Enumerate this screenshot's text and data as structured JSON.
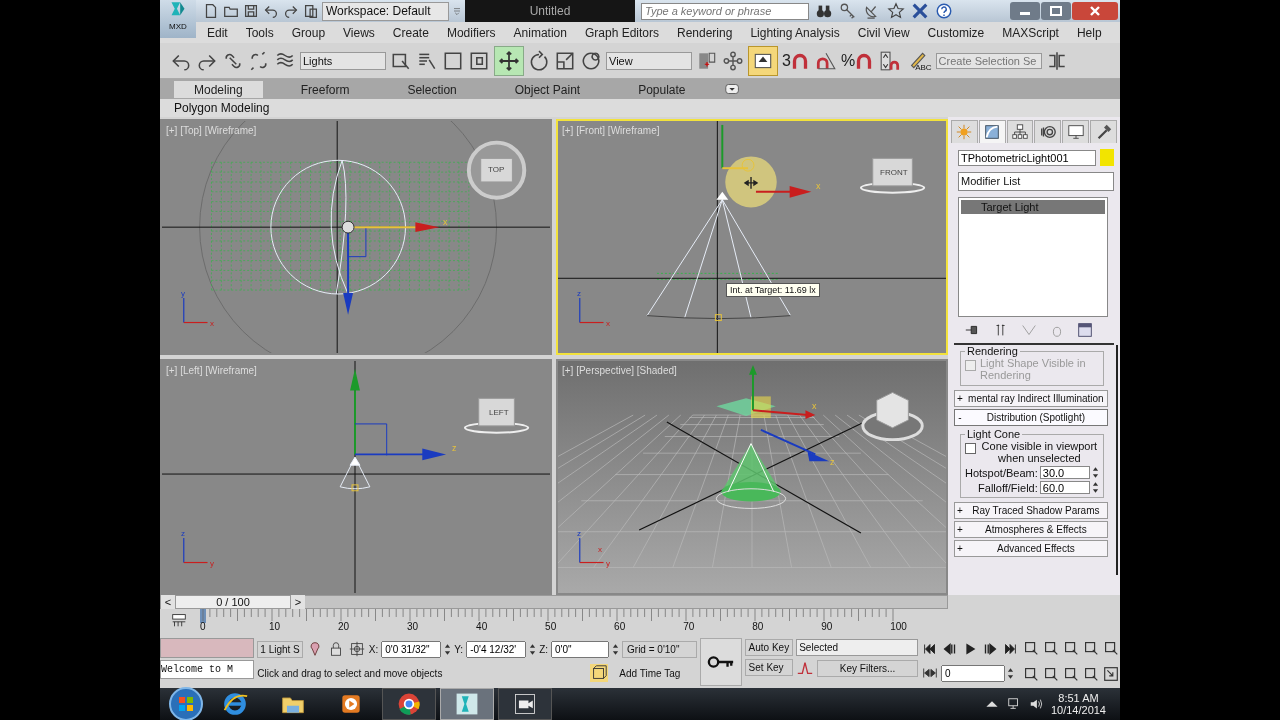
{
  "title_bar": {
    "app_badge": "MXD",
    "workspace": "Workspace: Default",
    "title": "Untitled",
    "search_placeholder": "Type a keyword or phrase"
  },
  "menu": [
    "Edit",
    "Tools",
    "Group",
    "Views",
    "Create",
    "Modifiers",
    "Animation",
    "Graph Editors",
    "Rendering",
    "Lighting Analysis",
    "Civil View",
    "Customize",
    "MAXScript",
    "Help"
  ],
  "toolbar": {
    "selection_filter": "Lights",
    "move_tool_on": true,
    "reference_coord": "View",
    "manipulate_on": true,
    "snap_label": "3",
    "percent_label": "%",
    "edit_named_label": "ABC",
    "named_selection_placeholder": "Create Selection Se"
  },
  "ribbon": {
    "tabs": [
      {
        "label": "Modeling",
        "selected": true
      },
      {
        "label": "Freeform",
        "selected": false
      },
      {
        "label": "Selection",
        "selected": false
      },
      {
        "label": "Object Paint",
        "selected": false
      },
      {
        "label": "Populate",
        "selected": false
      }
    ],
    "panel": "Polygon Modeling"
  },
  "viewports": [
    {
      "kind": "top",
      "label": "[+] [Top] [Wireframe]",
      "active": false,
      "cube": "TOP",
      "gizmo": [
        "x"
      ],
      "tripod": [
        "y",
        "x"
      ]
    },
    {
      "kind": "front",
      "label": "[+] [Front] [Wireframe]",
      "active": true,
      "cube": "FRONT",
      "gizmo": [
        "x"
      ],
      "tripod": [
        "z",
        "x"
      ],
      "tooltip": "Int. at Target: 11.69 lx"
    },
    {
      "kind": "left",
      "label": "[+] [Left] [Wireframe]",
      "active": false,
      "cube": "LEFT",
      "gizmo": [
        "z"
      ],
      "tripod": [
        "z",
        "y"
      ]
    },
    {
      "kind": "perspective",
      "label": "[+] [Perspective] [Shaded]",
      "active": false,
      "gizmo": [
        "x",
        "z"
      ],
      "tripod": [
        "z",
        "y",
        "x"
      ]
    }
  ],
  "command_panel": {
    "tabs": [
      {
        "selected": false
      },
      {
        "selected": true
      },
      {
        "selected": false
      },
      {
        "selected": false
      },
      {
        "selected": false
      },
      {
        "selected": false
      }
    ],
    "object_name": "TPhotometricLight001",
    "modifier_list": "Modifier List",
    "stack": [
      {
        "label": "Target Light",
        "selected": true
      }
    ],
    "rendering_group": {
      "title": "Rendering",
      "checkbox": {
        "label": "Light Shape Visible in Rendering",
        "checked": false,
        "disabled": true
      }
    },
    "rollouts": [
      {
        "sign": "+",
        "title": "mental ray Indirect Illumination",
        "expanded": false
      },
      {
        "sign": "-",
        "title": "Distribution (Spotlight)",
        "expanded": true
      },
      {
        "sign": "+",
        "title": "Ray Traced Shadow Params",
        "expanded": false
      },
      {
        "sign": "+",
        "title": "Atmospheres & Effects",
        "expanded": false
      },
      {
        "sign": "+",
        "title": "Advanced Effects",
        "expanded": false
      }
    ],
    "light_cone": {
      "title": "Light Cone",
      "checkbox": {
        "label": "Cone visible in viewport when unselected",
        "checked": false
      },
      "fields": [
        {
          "label": "Hotspot/Beam:",
          "value": "30.0"
        },
        {
          "label": "Falloff/Field:",
          "value": "60.0"
        }
      ]
    }
  },
  "timeline": {
    "level": 0,
    "prev": "<",
    "frame": "0 / 100",
    "next": ">",
    "ticks": [
      "0",
      "10",
      "20",
      "30",
      "40",
      "50",
      "60",
      "70",
      "80",
      "90",
      "100"
    ]
  },
  "status": {
    "listener": "Welcome to M",
    "selection": "1 Light S",
    "x_label": "X:",
    "x": "0'0 31/32\"",
    "y_label": "Y:",
    "y": "-0'4 12/32'",
    "z_label": "Z:",
    "z": "0'0\"",
    "grid": "Grid = 0'10\"",
    "prompt": "Click and drag to select and move objects",
    "time_tag": "Add Time Tag"
  },
  "animation": {
    "auto_key": "Auto Key",
    "set_key": "Set Key",
    "key_mode": "Selected",
    "key_filters": "Key Filters...",
    "frame": "0"
  },
  "taskbar": {
    "apps": [
      {
        "kind": "ie",
        "running": false,
        "selected": false
      },
      {
        "kind": "explorer",
        "running": false,
        "selected": false
      },
      {
        "kind": "media",
        "running": false,
        "selected": false
      },
      {
        "kind": "chrome",
        "running": true,
        "selected": false
      },
      {
        "kind": "max",
        "running": true,
        "selected": true
      },
      {
        "kind": "video",
        "running": true,
        "selected": false
      }
    ],
    "time": "8:51 AM",
    "date": "10/14/2014"
  }
}
